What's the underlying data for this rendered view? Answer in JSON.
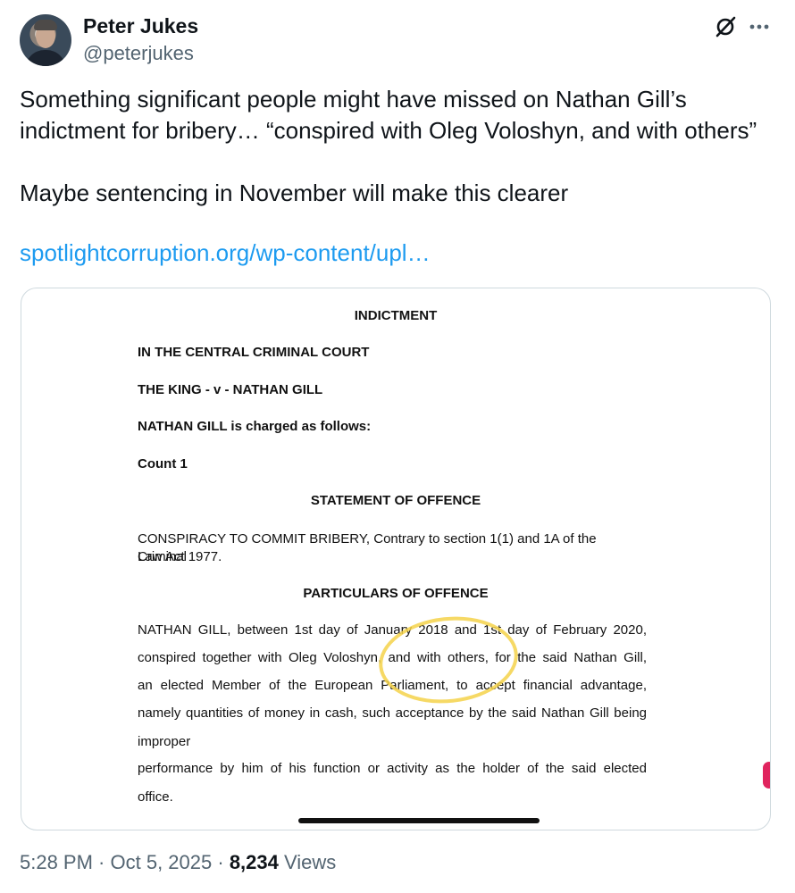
{
  "author": {
    "name": "Peter Jukes",
    "handle": "@peterjukes"
  },
  "icons": {
    "grok": "grok-icon",
    "more": "more-options-icon"
  },
  "tweet": {
    "text_line1": "Something significant people might have missed on Nathan Gill’s",
    "text_line2": "indictment for bribery… “conspired with Oleg Voloshyn, and with others”",
    "text_line3": "Maybe sentencing in November will make this clearer",
    "link": "spotlightcorruption.org/wp-content/upl…"
  },
  "document": {
    "title": "INDICTMENT",
    "court": "IN THE CENTRAL CRIMINAL COURT",
    "case": "THE KING - v - NATHAN GILL",
    "charged": "NATHAN GILL is charged as follows:",
    "count": "Count 1",
    "statement_heading": "STATEMENT OF OFFENCE",
    "statement_line1": "CONSPIRACY TO COMMIT BRIBERY, Contrary to section 1(1) and 1A of the Criminal",
    "statement_line2": "Law Act 1977.",
    "particulars_heading": "PARTICULARS OF OFFENCE",
    "particulars_lines": [
      "NATHAN GILL, between 1st day of January 2018 and 1st day of February 2020,",
      "conspired together with Oleg Voloshyn, and with others, for the said Nathan Gill,",
      "an elected Member of the European Parliament, to accept financial advantage,",
      "namely quantities of money in cash, such acceptance by the said Nathan Gill being",
      "improper",
      "performance by him of his function or activity as the holder of the said elected",
      "office."
    ]
  },
  "footer": {
    "time": "5:28 PM",
    "sep1": " · ",
    "date": "Oct 5, 2025",
    "sep2": " · ",
    "views_count": "8,234",
    "views_label": " Views"
  },
  "colors": {
    "link": "#1d9bf0",
    "secondary_text": "#536471",
    "highlight": "#f4d24a"
  }
}
